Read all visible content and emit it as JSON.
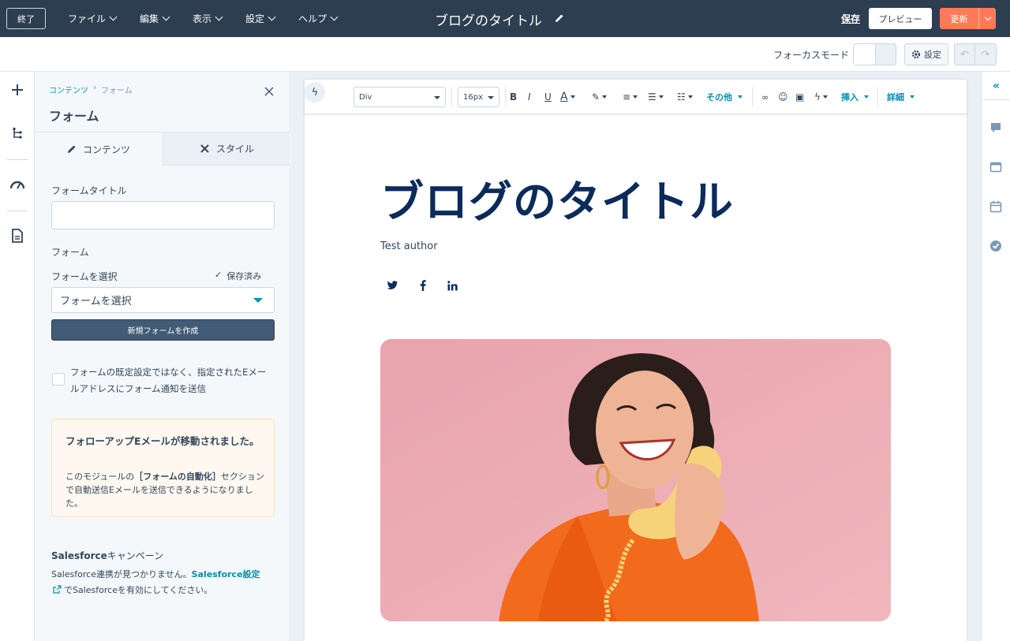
{
  "topbar": {
    "exit_label": "終了",
    "menu": [
      "ファイル",
      "編集",
      "表示",
      "設定",
      "ヘルプ"
    ],
    "doc_title": "ブログのタイトル",
    "save_label": "保存",
    "preview_label": "プレビュー",
    "update_label": "更新"
  },
  "subbar": {
    "focus_mode_label": "フォーカスモード",
    "focus_mode_on": false,
    "settings_label": "設定"
  },
  "panel": {
    "breadcrumb_parent": "コンテンツ",
    "breadcrumb_sep": "›",
    "breadcrumb_current": "フォーム",
    "title": "フォーム",
    "tab_content": "コンテンツ",
    "tab_style": "スタイル",
    "form_title_label": "フォームタイトル",
    "form_title_value": "",
    "form_label": "フォーム",
    "select_form_label": "フォームを選択",
    "saved_label": "保存済み",
    "select_value": "フォームを選択",
    "create_form_button": "新規フォームを作成",
    "checkbox_text": "フォームの既定設定ではなく、指定されたEメールアドレスにフォーム通知を送信",
    "checkbox_checked": false,
    "notice_title": "フォローアップEメールが移動されました。",
    "notice_body_pre": "このモジュールの",
    "notice_body_bold": "［フォームの自動化］",
    "notice_body_post": "セクションで自動送信Eメールを送信できるようになりました。",
    "sf_title_bold": "Salesforce",
    "sf_title_rest": "キャンペーン",
    "sf_body_pre": "Salesforce連携が見つかりません。",
    "sf_link": "Salesforce設定",
    "sf_body_post": "でSalesforceを有効にしてください。"
  },
  "toolbar": {
    "block_type": "Div",
    "font_size": "16px",
    "more_label": "その他",
    "insert_label": "挿入",
    "advanced_label": "詳細"
  },
  "post": {
    "title": "ブログのタイトル",
    "author": "Test author",
    "social_icons": [
      "twitter-icon",
      "facebook-icon",
      "linkedin-icon"
    ]
  },
  "colors": {
    "topbar_bg": "#2d3e50",
    "accent_orange": "#ff7a59",
    "link_teal": "#0091ae",
    "title_navy": "#0b2b5b"
  }
}
